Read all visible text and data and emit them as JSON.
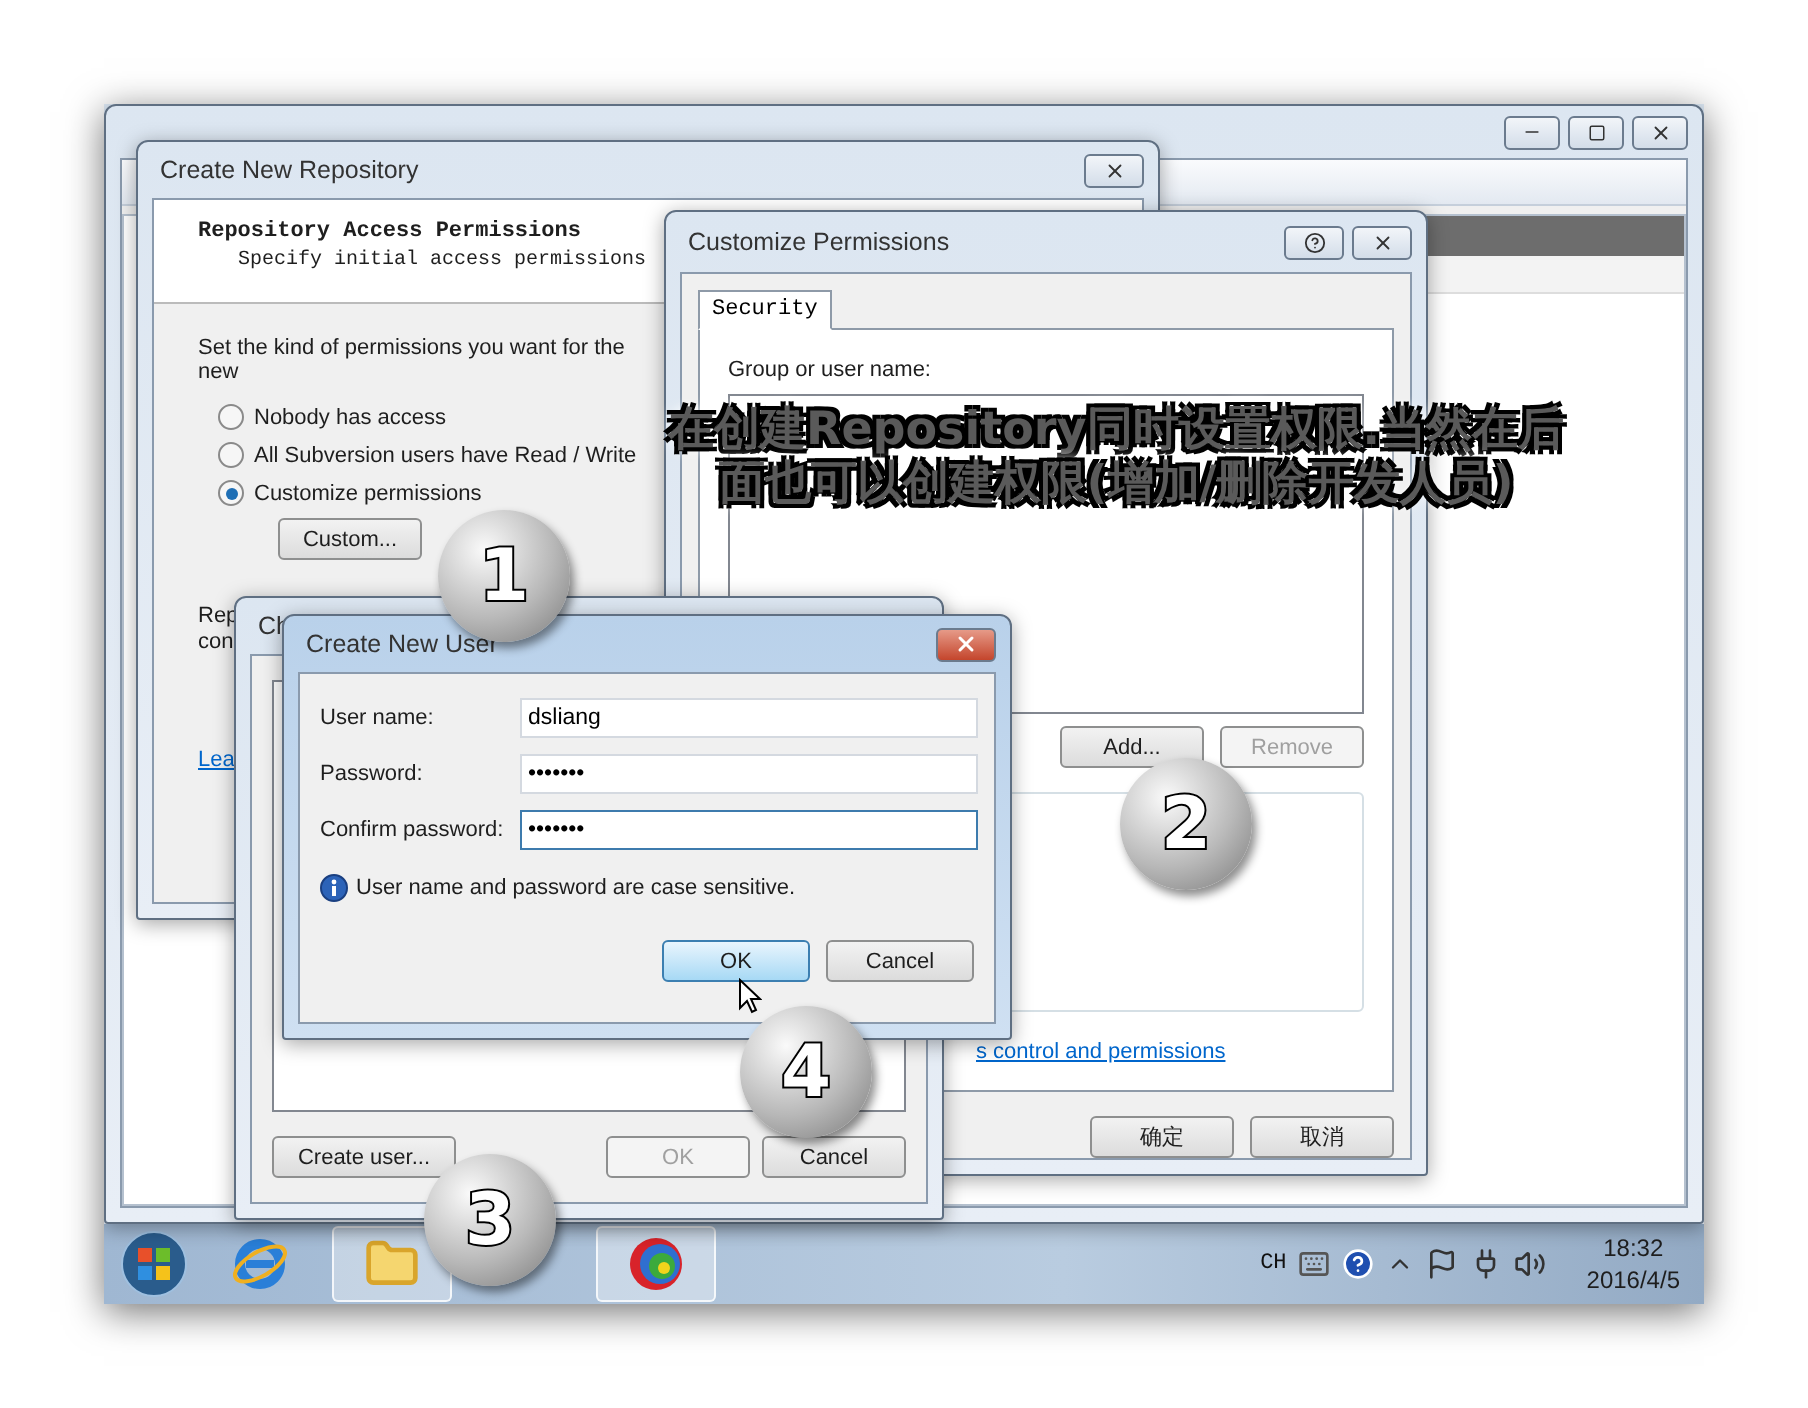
{
  "create_repository": {
    "title": "Create New Repository",
    "heading": "Repository Access Permissions",
    "subheading": "Specify initial access permissions",
    "prompt": "Set the kind of permissions you want for the new",
    "options": [
      {
        "label": "Nobody has access",
        "selected": false
      },
      {
        "label": "All Subversion users have Read / Write",
        "selected": false
      },
      {
        "label": "Customize permissions",
        "selected": true
      }
    ],
    "custom_button": "Custom...",
    "fragments": [
      "Rep",
      "con"
    ],
    "link": "Lea"
  },
  "customize_permissions": {
    "title": "Customize Permissions",
    "tabs": [
      {
        "label": "Security",
        "selected": true
      }
    ],
    "group_label": "Group or user name:",
    "buttons": [
      {
        "label": "Add...",
        "disabled": false
      },
      {
        "label": "Remove",
        "disabled": true
      }
    ],
    "link": "s control and permissions",
    "footer_buttons": [
      {
        "label": "确定",
        "disabled": false
      },
      {
        "label": "取消",
        "disabled": false
      }
    ]
  },
  "choose_users": {
    "title": "Ch",
    "create_button": {
      "label": "Create user...",
      "disabled": false
    },
    "footer_buttons": [
      {
        "label": "OK",
        "disabled": true
      },
      {
        "label": "Cancel",
        "disabled": false
      }
    ]
  },
  "create_user": {
    "title": "Create New User",
    "fields": [
      {
        "label": "User name:",
        "value": "dsliang",
        "focused": false
      },
      {
        "label": "Password:",
        "value": "•••••••",
        "focused": false
      },
      {
        "label": "Confirm password:",
        "value": "•••••••",
        "focused": true
      }
    ],
    "note": "User name and password are case sensitive.",
    "buttons": [
      {
        "label": "OK",
        "disabled": false,
        "highlighted": true
      },
      {
        "label": "Cancel",
        "disabled": false,
        "highlighted": false
      }
    ]
  },
  "annotation": "在创建Repository同时设置权限.当然在后面也可以创建权限(增加/删除开发人员)",
  "step_markers": [
    "1",
    "2",
    "3",
    "4"
  ],
  "taskbar": {
    "language": "CH",
    "time": "18:32",
    "date": "2016/4/5"
  }
}
